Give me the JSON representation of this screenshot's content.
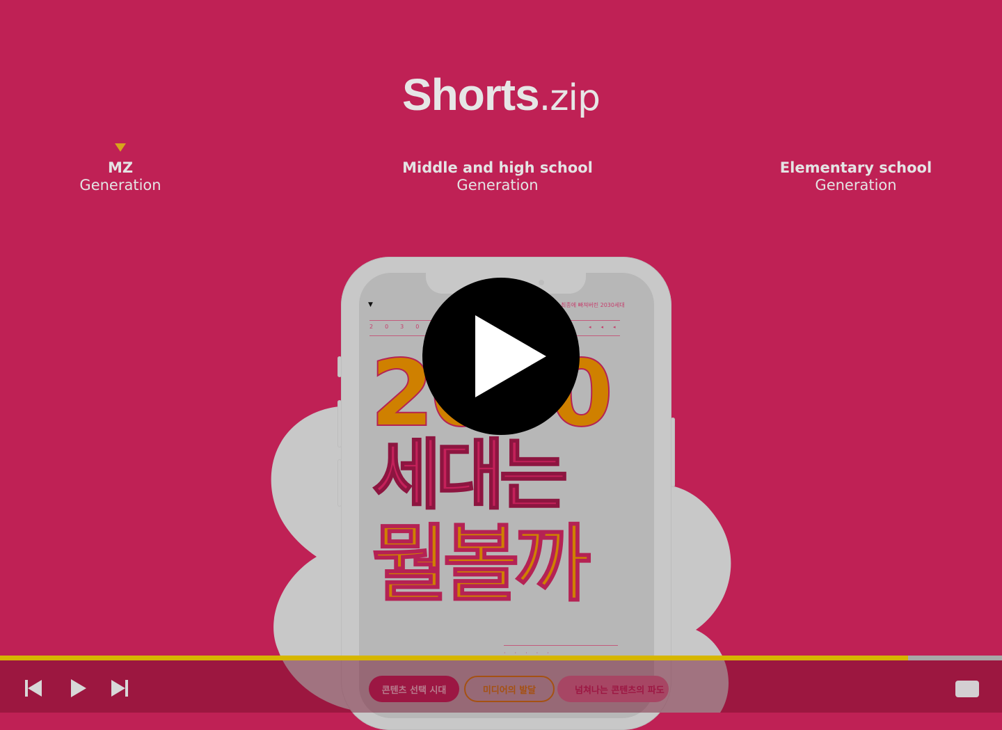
{
  "logo": {
    "word": "Shorts",
    "suffix": ".zip"
  },
  "tabs": [
    {
      "title": "MZ",
      "subtitle": "Generation",
      "selected": true
    },
    {
      "title": "Middle and high school",
      "subtitle": "Generation",
      "selected": false
    },
    {
      "title": "Elementary school",
      "subtitle": "Generation",
      "selected": false
    }
  ],
  "video": {
    "screen": {
      "subtitle": "최종에 빠져버린 2030세대",
      "digits": "2030",
      "headline_number": "2030",
      "headline_line1": "세대는",
      "headline_line2": "뭘볼까",
      "chips": [
        "콘텐츠 선택 시대",
        "미디어의 발달",
        "넘쳐나는 콘텐츠의 파도"
      ]
    },
    "progress": 0.906,
    "colors": {
      "background": "#bf2155",
      "progress": "#d6b600",
      "accent": "#d7a51c"
    }
  },
  "controls": {
    "icons": [
      "skip-previous-icon",
      "play-icon",
      "skip-next-icon",
      "fullscreen-icon"
    ]
  }
}
